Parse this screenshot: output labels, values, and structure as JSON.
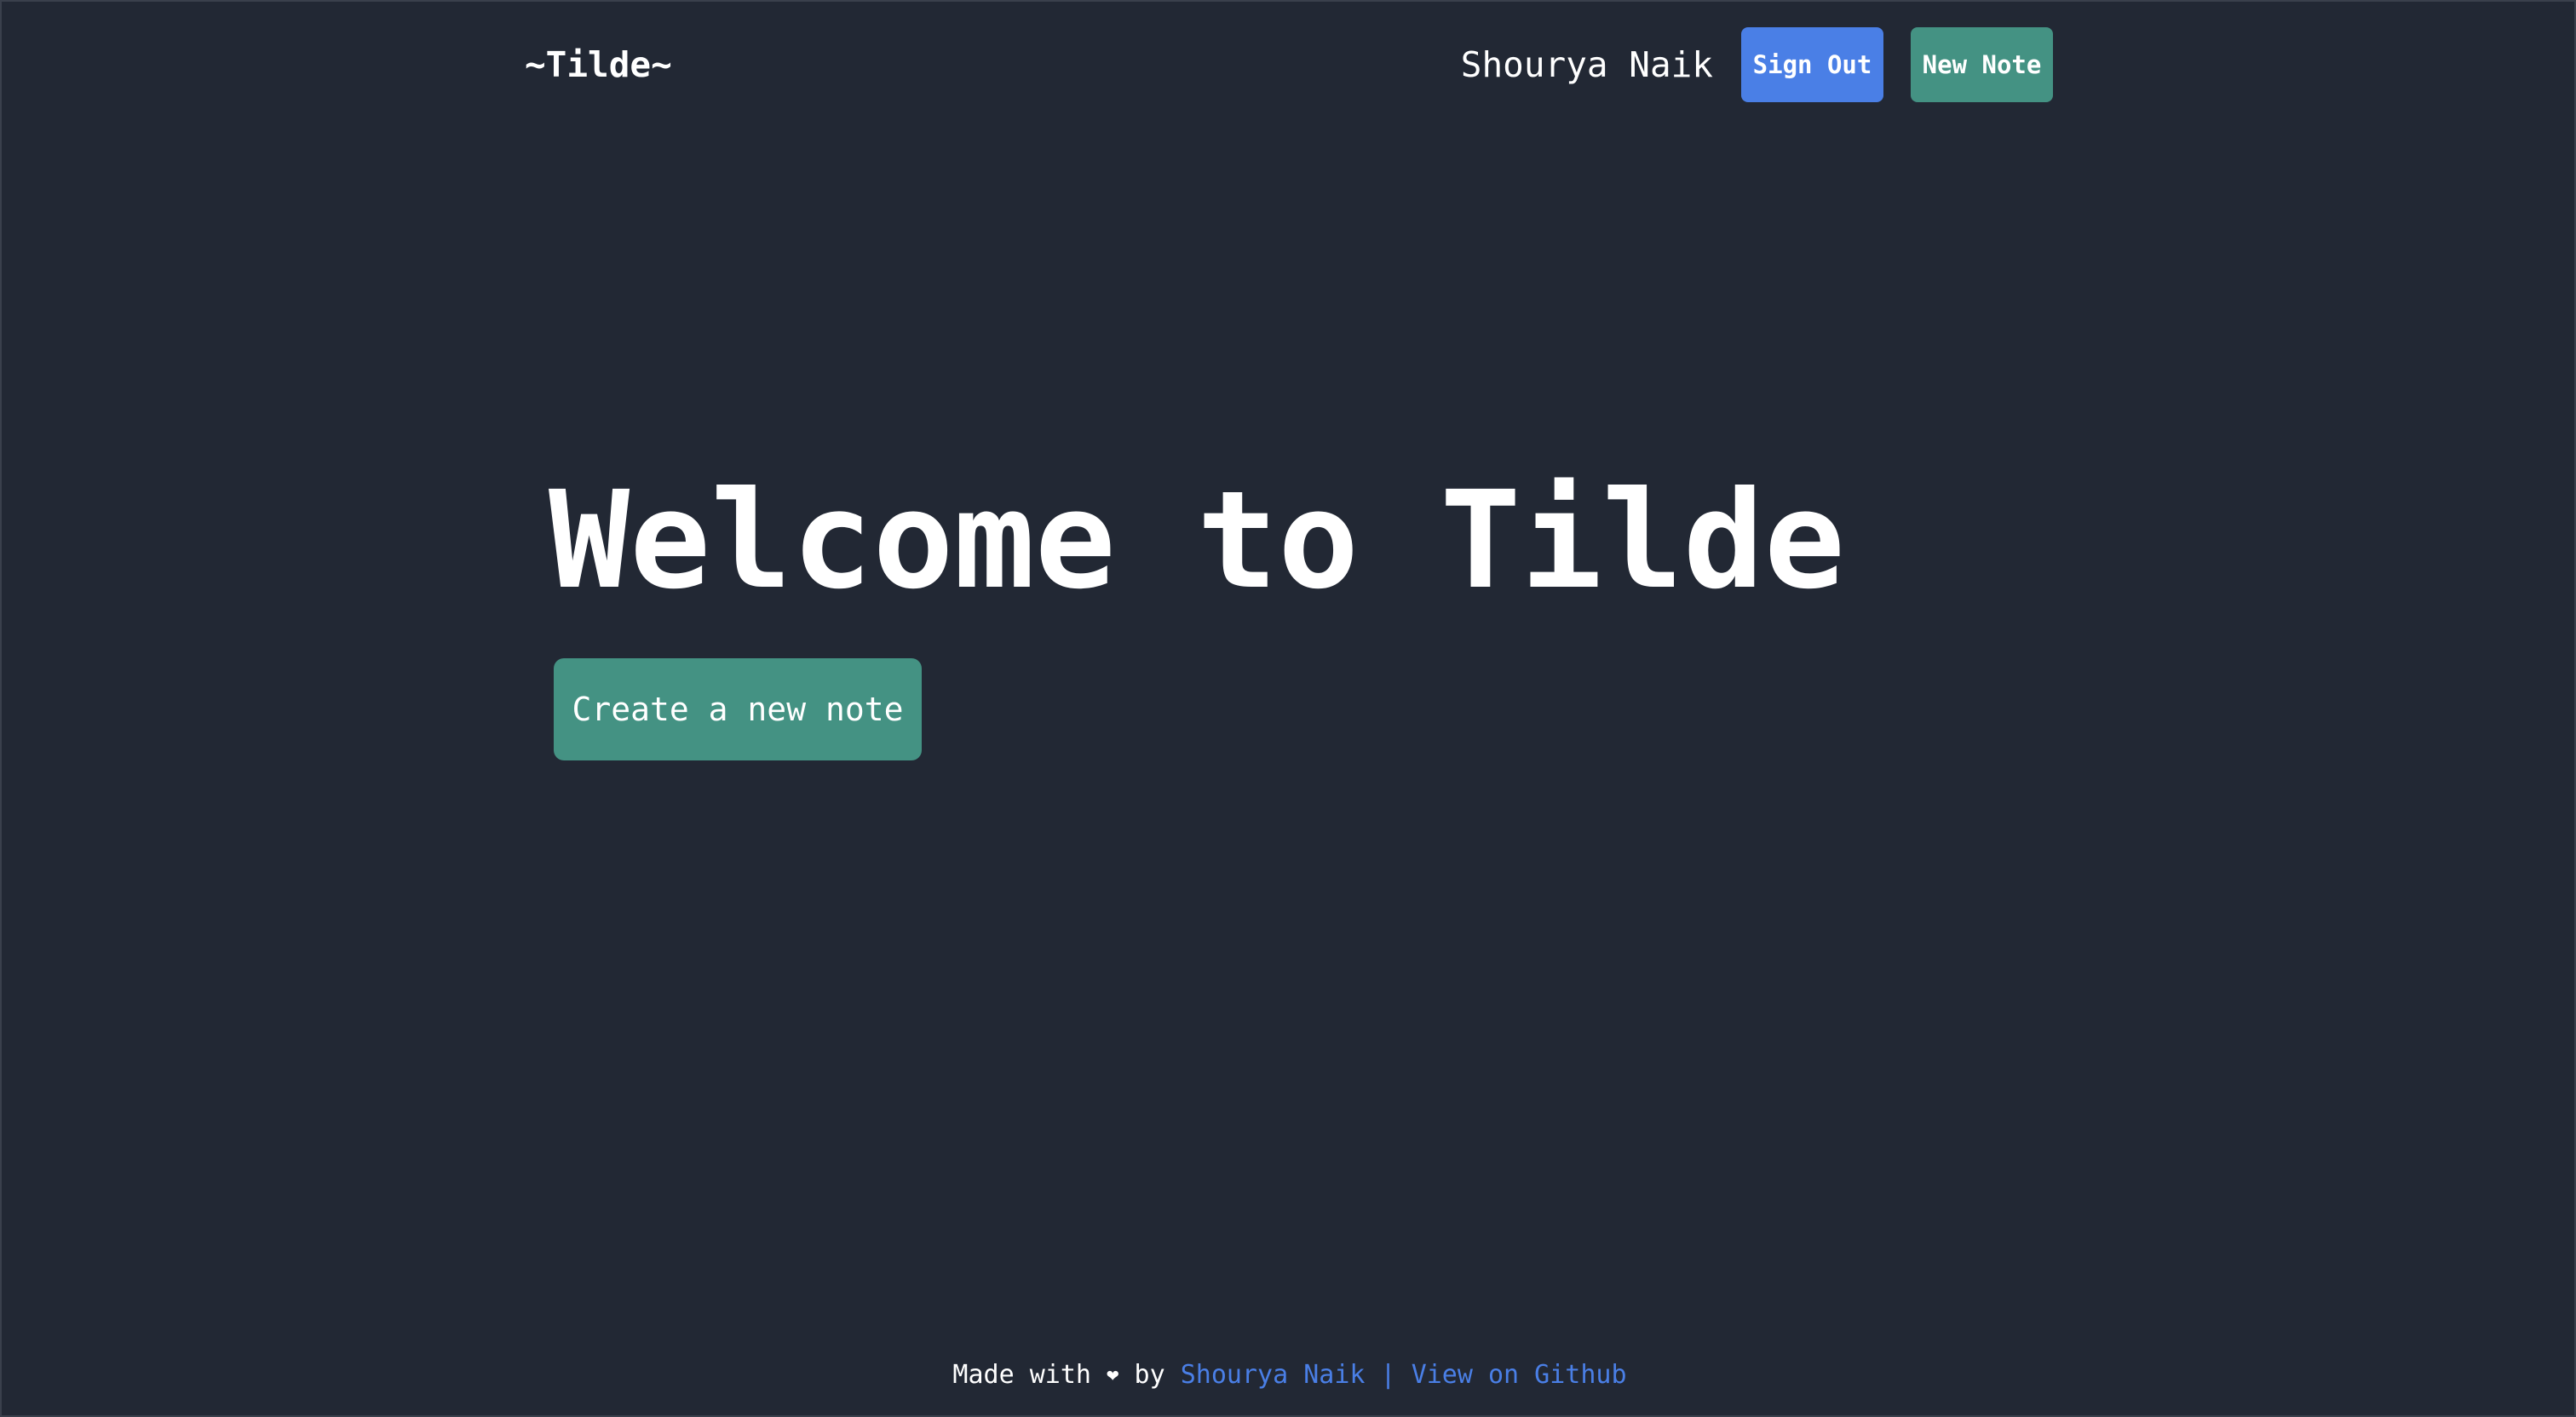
{
  "header": {
    "brand": "~Tilde~",
    "user_name": "Shourya Naik",
    "sign_out_label": "Sign Out",
    "new_note_label": "New Note"
  },
  "hero": {
    "title": "Welcome to Tilde",
    "create_label": "Create a new note"
  },
  "footer": {
    "made_with": "Made with ",
    "heart_icon": "heart-icon",
    "by": " by ",
    "author_link": "Shourya Naik",
    "separator": " | ",
    "github_link": "View on Github"
  },
  "colors": {
    "background": "#222834",
    "primary_blue": "#4a7fe6",
    "accent_teal": "#449283",
    "text": "#ffffff"
  }
}
